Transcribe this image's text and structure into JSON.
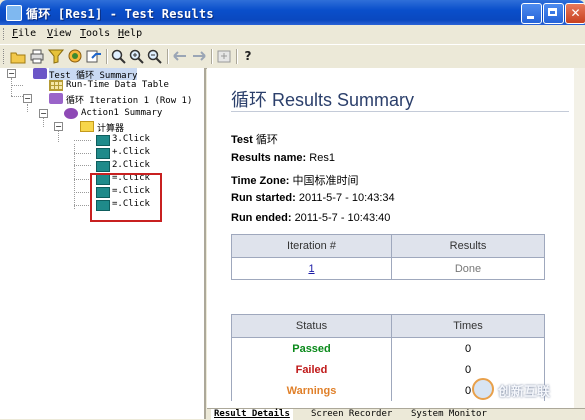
{
  "window": {
    "title": "循环 [Res1] - Test Results"
  },
  "menu": [
    {
      "label": "File",
      "key": "F"
    },
    {
      "label": "View",
      "key": "V"
    },
    {
      "label": "Tools",
      "key": "T"
    },
    {
      "label": "Help",
      "key": "H"
    }
  ],
  "toolbar": {
    "icons": [
      "open-icon",
      "print-icon",
      "filter-icon",
      "find-icon",
      "jump-to-step-icon",
      "zoom-in-icon",
      "zoom-out-icon",
      "back-icon",
      "forward-icon",
      "expand-icon",
      "help-icon"
    ],
    "help_label": "?"
  },
  "tree": {
    "root": "Test 循环 Summary",
    "runtime_table": "Run-Time Data Table",
    "iteration": "循环 Iteration 1 (Row 1)",
    "action": "Action1 Summary",
    "folder": "计算器",
    "steps": [
      "3.Click",
      "+.Click",
      "2.Click",
      "=.Click",
      "=.Click",
      "=.Click"
    ]
  },
  "summary": {
    "title": "循环  Results Summary",
    "test_label": "Test",
    "test_value": "循环",
    "results_name_label": "Results name:",
    "results_name_value": "Res1",
    "time_zone_label": "Time Zone:",
    "time_zone_value": "中国标准时间",
    "run_started_label": "Run started:",
    "run_started_value": "2011-5-7 - 10:43:34",
    "run_ended_label": "Run ended:",
    "run_ended_value": "2011-5-7 - 10:43:40"
  },
  "iteration_table": {
    "headers": [
      "Iteration #",
      "Results"
    ],
    "rows": [
      {
        "iteration": "1",
        "result": "Done"
      }
    ]
  },
  "status_table": {
    "headers": [
      "Status",
      "Times"
    ],
    "rows": [
      {
        "status": "Passed",
        "times": "0"
      },
      {
        "status": "Failed",
        "times": "0"
      },
      {
        "status": "Warnings",
        "times": "0"
      }
    ]
  },
  "tabs": [
    "Result Details",
    "Screen Recorder",
    "System Monitor"
  ],
  "watermark": {
    "text": "创新互联"
  },
  "colors": {
    "titlebar": "#0a4fcb",
    "passed": "#0a8a1a",
    "failed": "#c01818",
    "warnings": "#e0802a",
    "highlight_box": "#c82020"
  }
}
